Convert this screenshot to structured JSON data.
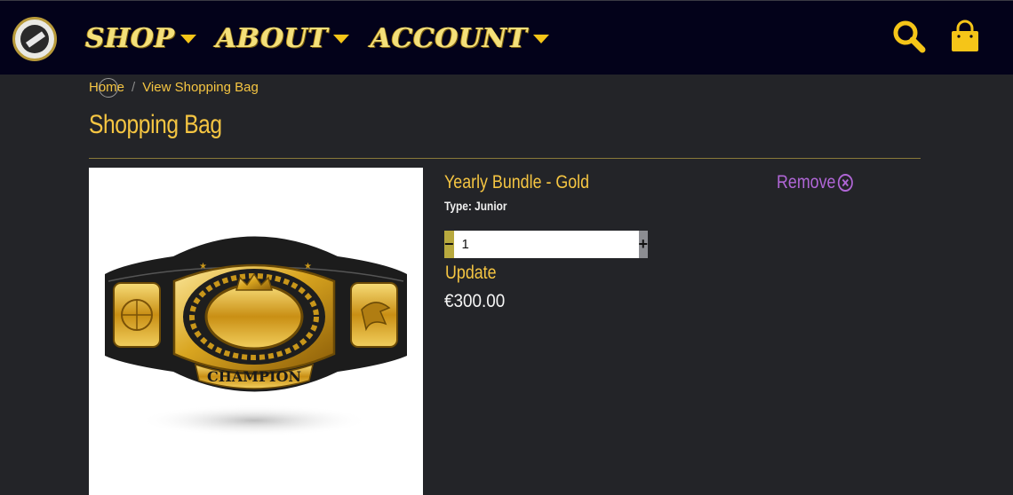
{
  "navbar": {
    "logo_icon": "club-logo",
    "items": [
      {
        "label": "SHOP"
      },
      {
        "label": "ABOUT"
      },
      {
        "label": "ACCOUNT"
      }
    ],
    "search_icon": "search-icon",
    "bag_icon": "shopping-bag-icon"
  },
  "breadcrumb": {
    "home": "Home",
    "separator": "/",
    "current": "View Shopping Bag"
  },
  "page": {
    "title": "Shopping Bag"
  },
  "bag_item": {
    "name": "Yearly Bundle - Gold",
    "type": "Type: Junior",
    "remove_label": "Remove",
    "quantity": "1",
    "minus_label": "−",
    "plus_label": "+",
    "update_label": "Update",
    "price": "€300.00",
    "image_text": "CHAMPION"
  },
  "colors": {
    "navbar_bg": "#03021a",
    "page_bg": "#232428",
    "accent_gold": "#f5c542",
    "remove_purple": "#b066d6"
  }
}
